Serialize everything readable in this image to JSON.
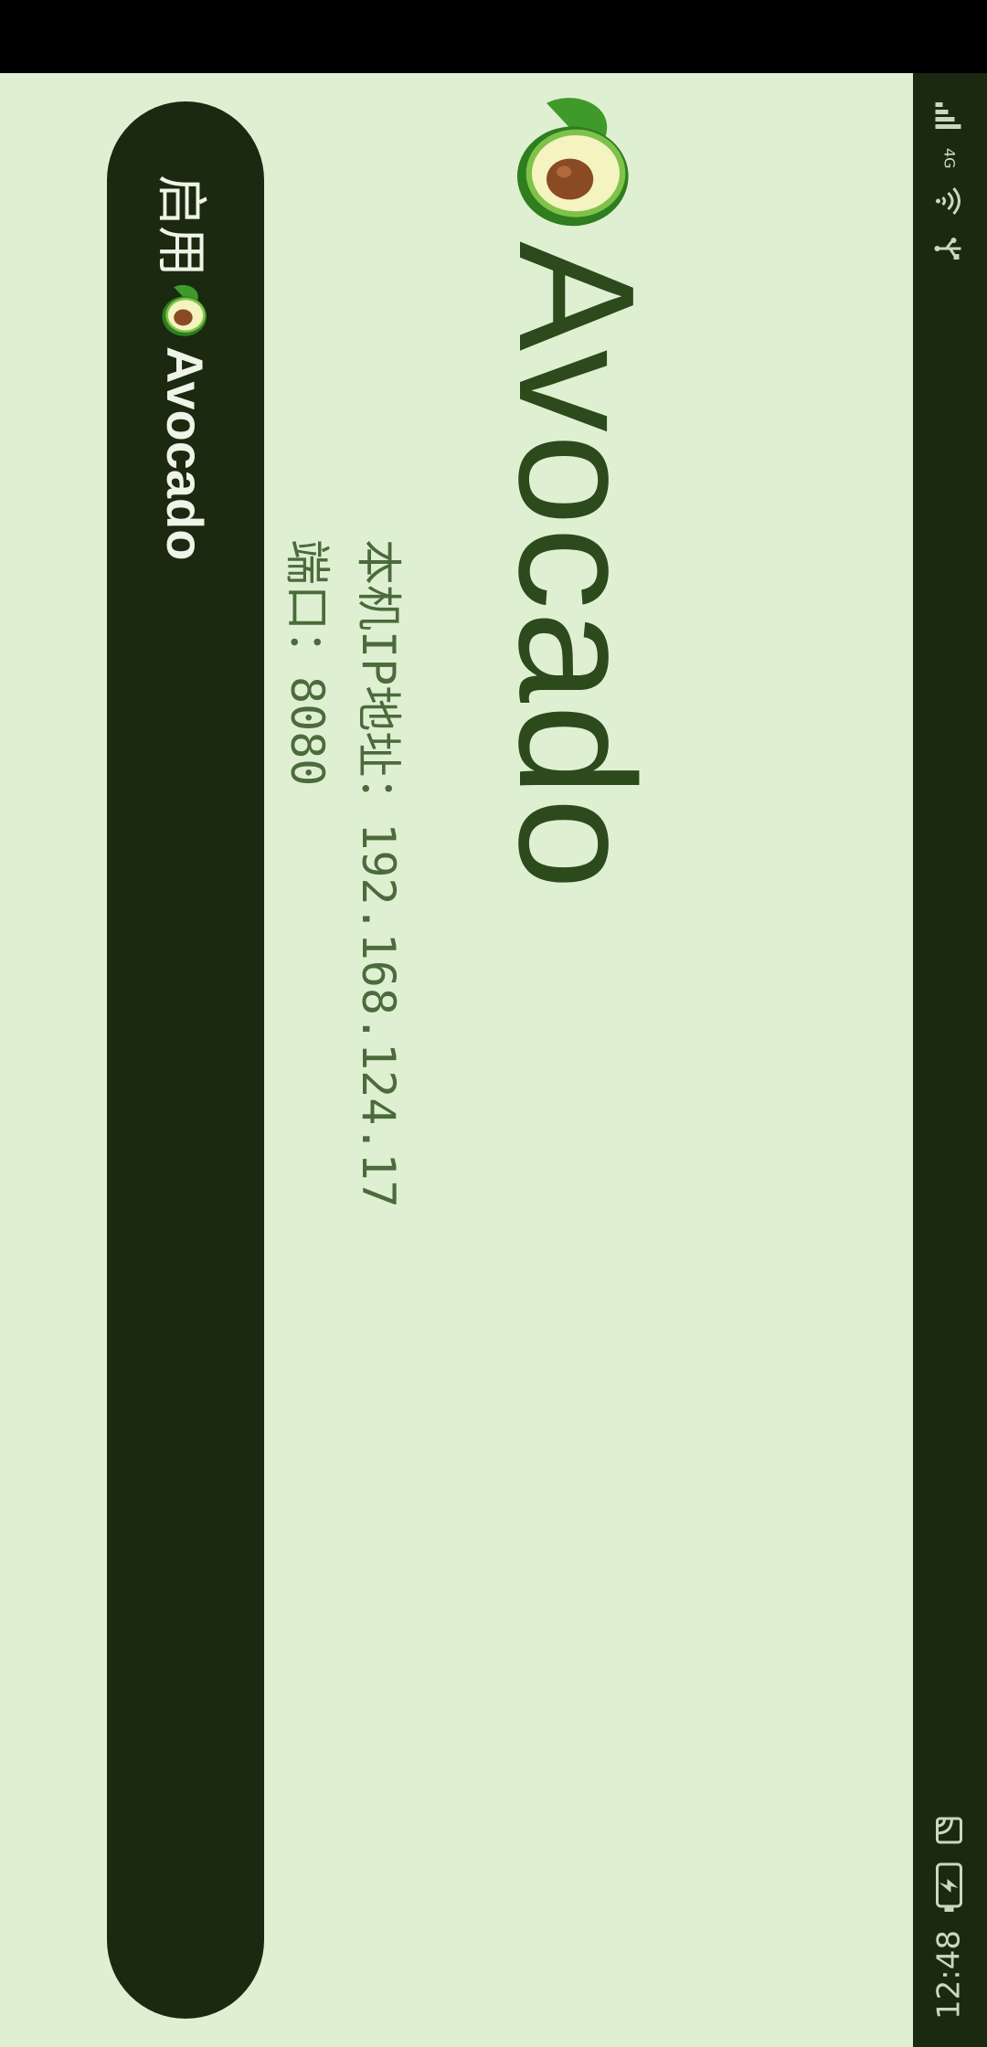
{
  "status_bar": {
    "time": "12:48",
    "network_label": "4G",
    "icons": [
      "signal-icon",
      "wifi-icon",
      "usb-icon",
      "cast-icon",
      "battery-charging-icon"
    ]
  },
  "app": {
    "title": "Avocado",
    "logo_icon": "avocado-icon",
    "ip_label": "本机IP地址：",
    "ip_value": "192.168.124.17",
    "port_label": "端口：",
    "port_value": "8080",
    "enable_button": {
      "prefix": "启用",
      "suffix": "Avocado"
    }
  },
  "colors": {
    "background": "#dff0d2",
    "dark": "#1a2910",
    "title": "#2d4a1d",
    "info_text": "#4c6b3c"
  }
}
